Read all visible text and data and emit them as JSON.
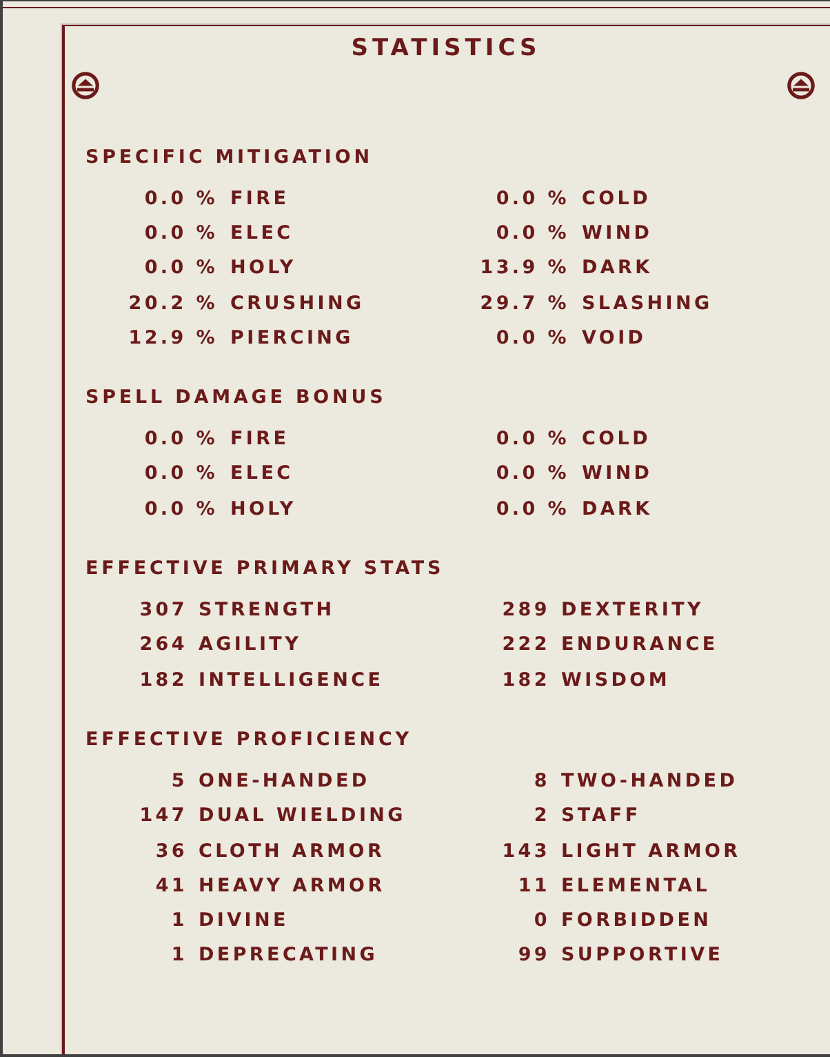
{
  "window": {
    "title": "STATISTICS"
  },
  "sections": [
    {
      "heading": "SPECIFIC MITIGATION",
      "kind": "percent",
      "items": [
        {
          "value": "0.0 %",
          "label": "FIRE"
        },
        {
          "value": "0.0 %",
          "label": "COLD"
        },
        {
          "value": "0.0 %",
          "label": "ELEC"
        },
        {
          "value": "0.0 %",
          "label": "WIND"
        },
        {
          "value": "0.0 %",
          "label": "HOLY"
        },
        {
          "value": "13.9 %",
          "label": "DARK"
        },
        {
          "value": "20.2 %",
          "label": "CRUSHING"
        },
        {
          "value": "29.7 %",
          "label": "SLASHING"
        },
        {
          "value": "12.9 %",
          "label": "PIERCING"
        },
        {
          "value": "0.0 %",
          "label": "VOID"
        }
      ]
    },
    {
      "heading": "SPELL DAMAGE BONUS",
      "kind": "percent",
      "items": [
        {
          "value": "0.0 %",
          "label": "FIRE"
        },
        {
          "value": "0.0 %",
          "label": "COLD"
        },
        {
          "value": "0.0 %",
          "label": "ELEC"
        },
        {
          "value": "0.0 %",
          "label": "WIND"
        },
        {
          "value": "0.0 %",
          "label": "HOLY"
        },
        {
          "value": "0.0 %",
          "label": "DARK"
        }
      ]
    },
    {
      "heading": "EFFECTIVE PRIMARY STATS",
      "kind": "number",
      "items": [
        {
          "value": "307",
          "label": "STRENGTH"
        },
        {
          "value": "289",
          "label": "DEXTERITY"
        },
        {
          "value": "264",
          "label": "AGILITY"
        },
        {
          "value": "222",
          "label": "ENDURANCE"
        },
        {
          "value": "182",
          "label": "INTELLIGENCE"
        },
        {
          "value": "182",
          "label": "WISDOM"
        }
      ]
    },
    {
      "heading": "EFFECTIVE PROFICIENCY",
      "kind": "number",
      "items": [
        {
          "value": "5",
          "label": "ONE-HANDED"
        },
        {
          "value": "8",
          "label": "TWO-HANDED"
        },
        {
          "value": "147",
          "label": "DUAL WIELDING"
        },
        {
          "value": "2",
          "label": "STAFF"
        },
        {
          "value": "36",
          "label": "CLOTH ARMOR"
        },
        {
          "value": "143",
          "label": "LIGHT ARMOR"
        },
        {
          "value": "41",
          "label": "HEAVY ARMOR"
        },
        {
          "value": "11",
          "label": "ELEMENTAL"
        },
        {
          "value": "1",
          "label": "DIVINE"
        },
        {
          "value": "0",
          "label": "FORBIDDEN"
        },
        {
          "value": "1",
          "label": "DEPRECATING"
        },
        {
          "value": "99",
          "label": "SUPPORTIVE"
        }
      ]
    }
  ]
}
